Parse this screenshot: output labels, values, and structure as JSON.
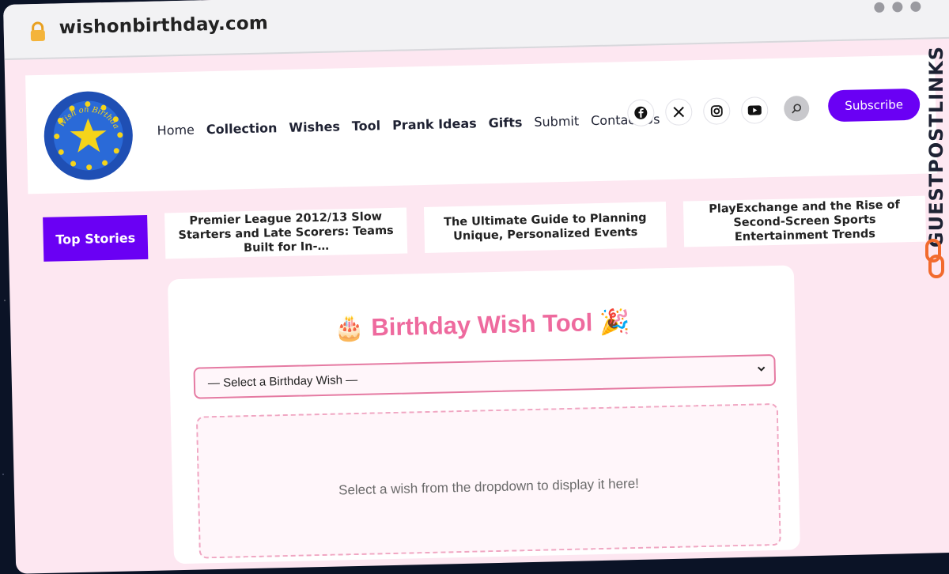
{
  "browser": {
    "url": "wishonbirthday.com"
  },
  "header": {
    "logo_text": "Wish on Birthday",
    "nav": [
      {
        "label": "Home",
        "bold": false
      },
      {
        "label": "Collection",
        "bold": true
      },
      {
        "label": "Wishes",
        "bold": true
      },
      {
        "label": "Tool",
        "bold": true
      },
      {
        "label": "Prank Ideas",
        "bold": true
      },
      {
        "label": "Gifts",
        "bold": true
      },
      {
        "label": "Submit",
        "bold": false
      },
      {
        "label": "Contact Us",
        "bold": false
      }
    ],
    "socials": [
      "facebook-icon",
      "x-icon",
      "instagram-icon",
      "youtube-icon"
    ],
    "subscribe_label": "Subscribe"
  },
  "stories": {
    "label": "Top Stories",
    "items": [
      "Premier League 2012/13 Slow Starters and Late Scorers: Teams Built for In-…",
      "The Ultimate Guide to Planning Unique, Personalized Events",
      "PlayExchange and the Rise of Second-Screen Sports Entertainment Trends"
    ]
  },
  "tool": {
    "title": "🎂 Birthday Wish Tool 🎉",
    "select_value": "— Select a Birthday Wish —",
    "placeholder": "Select a wish from the dropdown to display it here!"
  },
  "watermark": "GUESTPOSTLINKS",
  "colors": {
    "accent": "#6a00f4",
    "pink": "#ee6a9e",
    "page_bg": "#fde7f1"
  }
}
